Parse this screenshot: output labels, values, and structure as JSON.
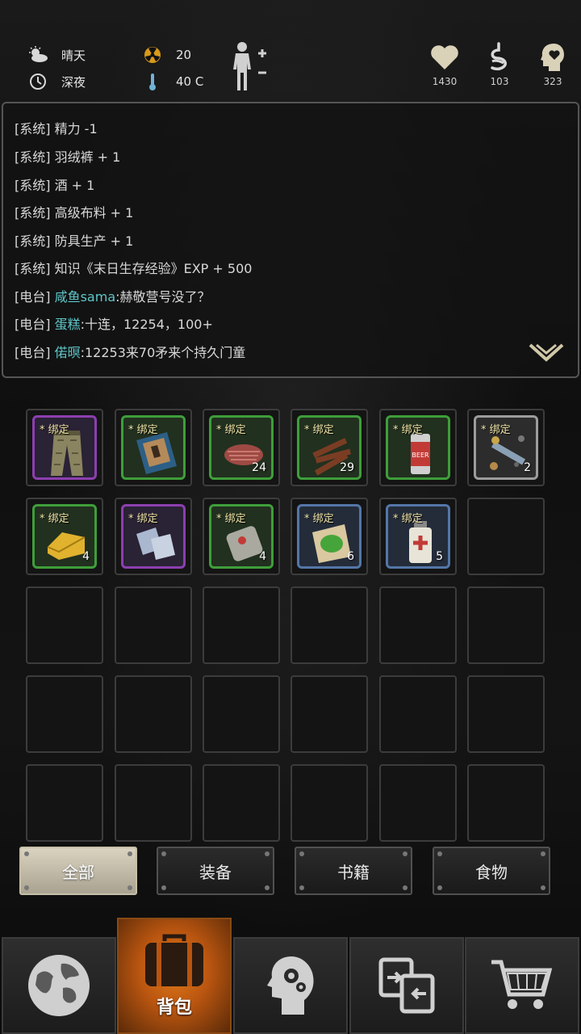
{
  "status": {
    "weather": "晴天",
    "time_of_day": "深夜",
    "radiation": "20",
    "temperature": "40 C",
    "vitals": {
      "health": "1430",
      "hunger": "103",
      "mind": "323"
    }
  },
  "log": [
    {
      "channel": "[系统]",
      "name": "",
      "text": "精力 -1"
    },
    {
      "channel": "[系统]",
      "name": "",
      "text": "羽绒裤 + 1"
    },
    {
      "channel": "[系统]",
      "name": "",
      "text": "酒 + 1"
    },
    {
      "channel": "[系统]",
      "name": "",
      "text": "高级布料 + 1"
    },
    {
      "channel": "[系统]",
      "name": "",
      "text": "防具生产 + 1"
    },
    {
      "channel": "[系统]",
      "name": "",
      "text": "知识《末日生存经验》EXP + 500"
    },
    {
      "channel": "[电台]",
      "name": "咸鱼sama",
      "text": ":赫敬营号没了？"
    },
    {
      "channel": "[电台]",
      "name": "蛋糕",
      "text": ":十连，12254，100+"
    },
    {
      "channel": "[电台]",
      "name": "偌暝",
      "text": ":12253来70矛来个持久门童"
    }
  ],
  "bind_label": "* 绑定",
  "inventory": [
    {
      "item": "pants",
      "rarity": "purple",
      "qty": ""
    },
    {
      "item": "book",
      "rarity": "green",
      "qty": ""
    },
    {
      "item": "meat",
      "rarity": "green",
      "qty": "24"
    },
    {
      "item": "jerky",
      "rarity": "green",
      "qty": "29"
    },
    {
      "item": "beer",
      "rarity": "green",
      "qty": ""
    },
    {
      "item": "scrap",
      "rarity": "grey",
      "qty": "2"
    },
    {
      "item": "cheese",
      "rarity": "green",
      "qty": "4"
    },
    {
      "item": "cloth",
      "rarity": "purple",
      "qty": ""
    },
    {
      "item": "canned-food",
      "rarity": "green",
      "qty": "4"
    },
    {
      "item": "herb",
      "rarity": "blue",
      "qty": "6"
    },
    {
      "item": "medicine",
      "rarity": "blue",
      "qty": "5"
    }
  ],
  "beer_label": "BEER",
  "filters": [
    "全部",
    "装备",
    "书籍",
    "食物"
  ],
  "nav": {
    "active_label": "背包"
  }
}
